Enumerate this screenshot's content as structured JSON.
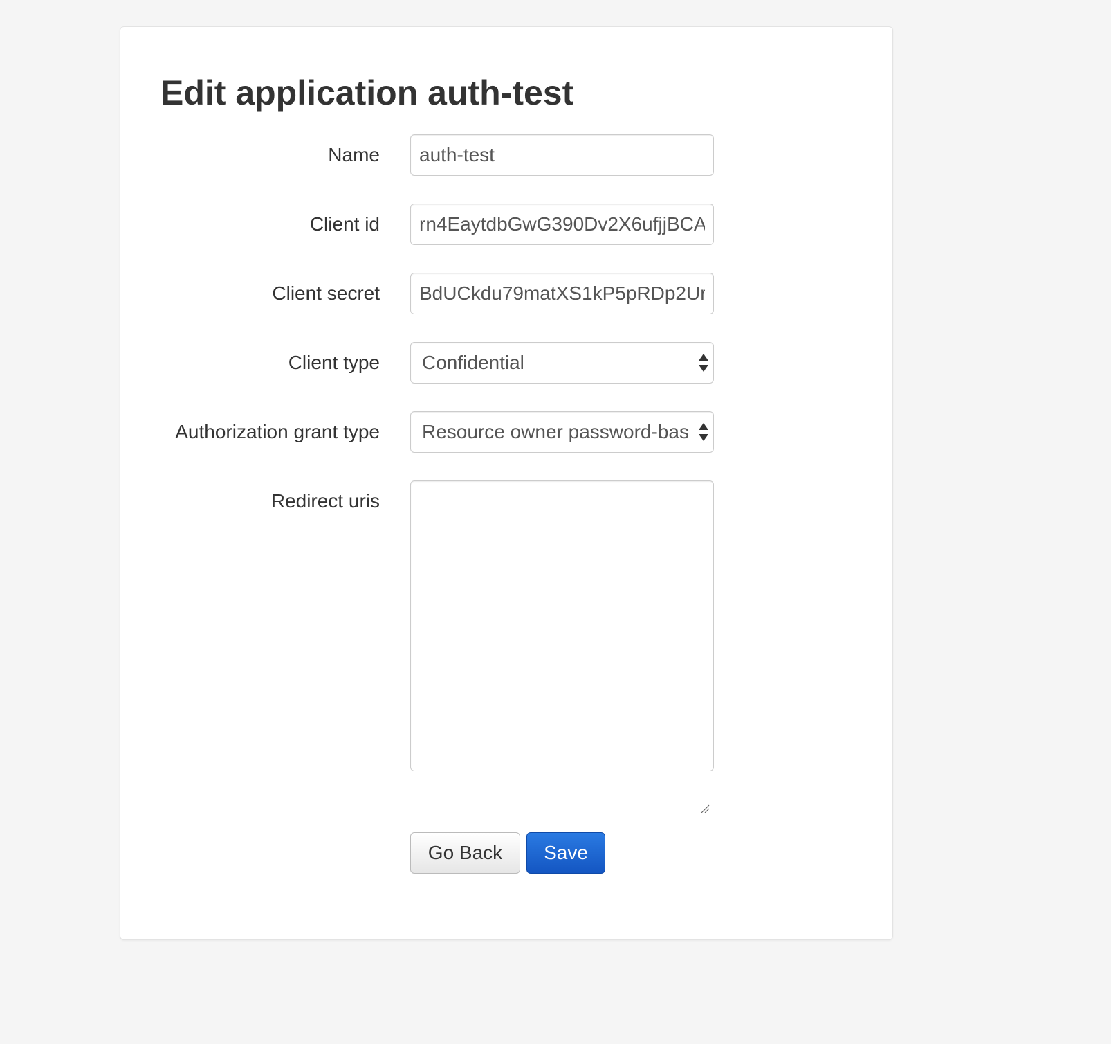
{
  "page": {
    "title": "Edit application auth-test"
  },
  "form": {
    "name": {
      "label": "Name",
      "value": "auth-test"
    },
    "client_id": {
      "label": "Client id",
      "value": "rn4EaytdbGwG390Dv2X6ufjjBCA"
    },
    "client_secret": {
      "label": "Client secret",
      "value": "BdUCkdu79matXS1kP5pRDp2Ur"
    },
    "client_type": {
      "label": "Client type",
      "selected": "Confidential"
    },
    "grant_type": {
      "label": "Authorization grant type",
      "selected": "Resource owner password-bas"
    },
    "redirect_uris": {
      "label": "Redirect uris",
      "value": ""
    }
  },
  "buttons": {
    "go_back": "Go Back",
    "save": "Save"
  },
  "colors": {
    "background": "#f5f5f5",
    "card": "#ffffff",
    "primary": "#1a62d4",
    "text": "#333333"
  },
  "icons": {
    "select_arrows": "up-down-arrows-icon",
    "resize_handle": "resize-grip-icon"
  }
}
